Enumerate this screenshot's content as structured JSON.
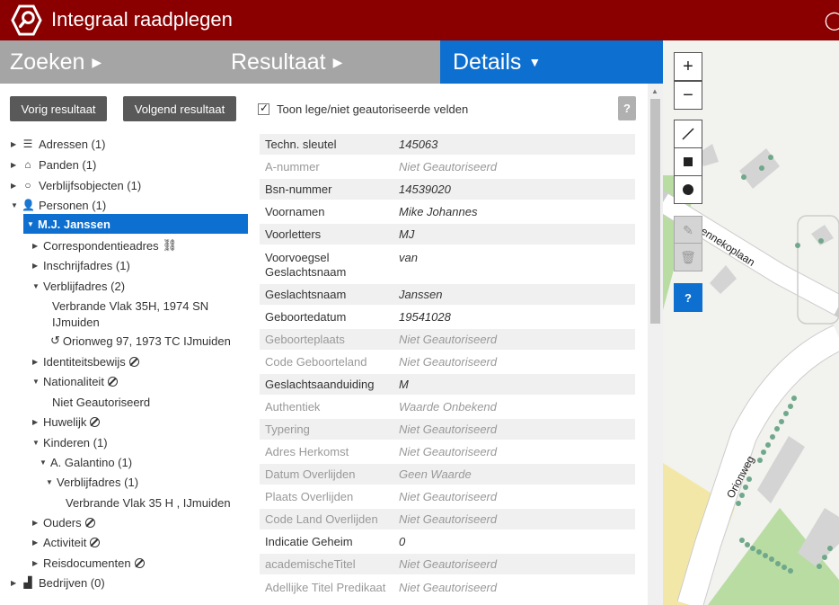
{
  "header": {
    "title": "Integraal raadplegen"
  },
  "tabs": [
    {
      "label": "Zoeken"
    },
    {
      "label": "Resultaat"
    },
    {
      "label": "Details"
    }
  ],
  "buttons": {
    "prev": "Vorig resultaat",
    "next": "Volgend resultaat"
  },
  "tree": {
    "adressen": "Adressen (1)",
    "panden": "Panden (1)",
    "verblijfsobjecten": "Verblijfsobjecten (1)",
    "personen": "Personen (1)",
    "person": "M.J. Janssen",
    "correspondentieadres": "Correspondentieadres",
    "inschrijfadres": "Inschrijfadres (1)",
    "verblijfadres": "Verblijfadres (2)",
    "verblijfadres_1_line1": "Verbrande Vlak 35H, 1974 SN",
    "verblijfadres_1_line2": "IJmuiden",
    "verblijfadres_2": "Orionweg 97, 1973 TC  IJmuiden",
    "identiteitsbewijs": "Identiteitsbewijs",
    "nationaliteit": "Nationaliteit",
    "nationaliteit_value": "Niet Geautoriseerd",
    "huwelijk": "Huwelijk",
    "kinderen": "Kinderen (1)",
    "kind": "A. Galantino (1)",
    "kind_verblijfadres": "Verblijfadres (1)",
    "kind_verblijfadres_value": "Verbrande Vlak 35 H , IJmuiden",
    "ouders": "Ouders",
    "activiteit": "Activiteit",
    "reisdocumenten": "Reisdocumenten",
    "bedrijven": "Bedrijven (0)"
  },
  "details": {
    "checkbox_label": "Toon lege/niet geautoriseerde velden",
    "help": "?",
    "fields": [
      {
        "name": "Techn. sleutel",
        "value": "145063"
      },
      {
        "name": "A-nummer",
        "value": "Niet Geautoriseerd"
      },
      {
        "name": "Bsn-nummer",
        "value": "14539020"
      },
      {
        "name": "Voornamen",
        "value": "Mike Johannes"
      },
      {
        "name": "Voorletters",
        "value": "MJ"
      },
      {
        "name": "Voorvoegsel Geslachtsnaam",
        "value": "van"
      },
      {
        "name": "Geslachtsnaam",
        "value": "Janssen"
      },
      {
        "name": "Geboortedatum",
        "value": "19541028"
      },
      {
        "name": "Geboorteplaats",
        "value": "Niet Geautoriseerd"
      },
      {
        "name": "Code Geboorteland",
        "value": "Niet Geautoriseerd"
      },
      {
        "name": "Geslachtsaanduiding",
        "value": "M"
      },
      {
        "name": "Authentiek",
        "value": "Waarde Onbekend"
      },
      {
        "name": "Typering",
        "value": "Niet Geautoriseerd"
      },
      {
        "name": "Adres Herkomst",
        "value": "Niet Geautoriseerd"
      },
      {
        "name": "Datum Overlijden",
        "value": "Geen Waarde"
      },
      {
        "name": "Plaats Overlijden",
        "value": "Niet Geautoriseerd"
      },
      {
        "name": "Code Land Overlijden",
        "value": "Niet Geautoriseerd"
      },
      {
        "name": "Indicatie Geheim",
        "value": "0"
      },
      {
        "name": "academischeTitel",
        "value": "Niet Geautoriseerd"
      },
      {
        "name": "Adellijke Titel Predikaat",
        "value": "Niet Geautoriseerd"
      }
    ]
  },
  "map": {
    "zoom_in": "+",
    "zoom_out": "−",
    "help": "?",
    "street_1": "Dennekoplaan",
    "street_2": "Orionweg"
  },
  "colors": {
    "header": "#8a0000",
    "accent": "#0d6fcf",
    "tabs": "#a5a5a5"
  }
}
